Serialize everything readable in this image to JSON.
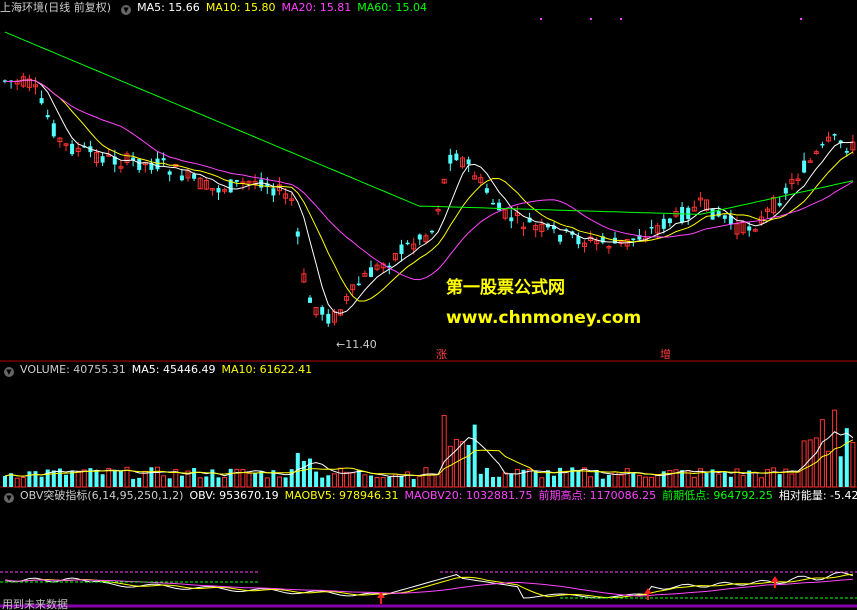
{
  "price_panel": {
    "stock_name": "上海环境(日线 前复权)",
    "ma5": "MA5: 15.66",
    "ma10": "MA10: 15.80",
    "ma20": "MA20: 15.81",
    "ma60": "MA60: 15.04",
    "low_label": "←11.40",
    "mark_zhang": "涨",
    "mark_zeng": "增"
  },
  "watermark": {
    "line1": "第一股票公式网",
    "line2": "www.chnmoney.com"
  },
  "volume_panel": {
    "volume": "VOLUME: 40755.31",
    "ma5": "MA5: 45446.49",
    "ma10": "MA10: 61622.41"
  },
  "obv_panel": {
    "indicator": "OBV突破指标(6,14,95,250,1,2)",
    "obv": "OBV: 953670.19",
    "maobv5": "MAOBV5: 978946.31",
    "maobv20": "MAOBV20: 1032881.75",
    "prev_high": "前期高点: 1170086.25",
    "prev_low": "前期低点: 964792.25",
    "rel_energy": "相对能量: -5.42"
  },
  "footer": {
    "note": "用到未来数据"
  },
  "colors": {
    "up": "#ff3232",
    "down": "#54ffff",
    "ma5": "#ffffff",
    "ma10": "#ffff00",
    "ma20": "#ff44ff",
    "ma60": "#00ff00",
    "axis": "#b00000"
  }
}
